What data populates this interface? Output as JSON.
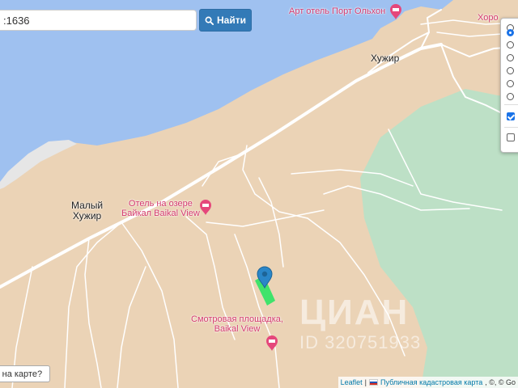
{
  "search": {
    "value": ":1636",
    "button_label": "Найти"
  },
  "map": {
    "towns": [
      {
        "line1": "Хужир",
        "line2": ""
      },
      {
        "line1": "Малый",
        "line2": "Хужир"
      }
    ],
    "pois": [
      {
        "line1": "Арт отель Порт Ольхон",
        "line2": ""
      },
      {
        "line1": "Отель на озере",
        "line2": "Байкал Baikal View"
      },
      {
        "line1": "Смотровая площадка,",
        "line2": "Baikal View"
      },
      {
        "line1": "Хоро",
        "line2": ""
      }
    ],
    "colors": {
      "water": "#9fc1f0",
      "land": "#ebd3b6",
      "forest": "#bde0c6",
      "road": "#ffffff",
      "parcel": "#3fe36b",
      "marker": "#2a86c8",
      "poi": "#d43a6e"
    }
  },
  "report_button": {
    "label": "м на карте?"
  },
  "attribution": {
    "leaflet": "Leaflet",
    "sep": "|",
    "kadastr": "Публичная кадастровая карта",
    "rest": ", ©, © Go"
  },
  "watermark": {
    "brand": "ЦИАН",
    "id": "ID 320751933"
  }
}
